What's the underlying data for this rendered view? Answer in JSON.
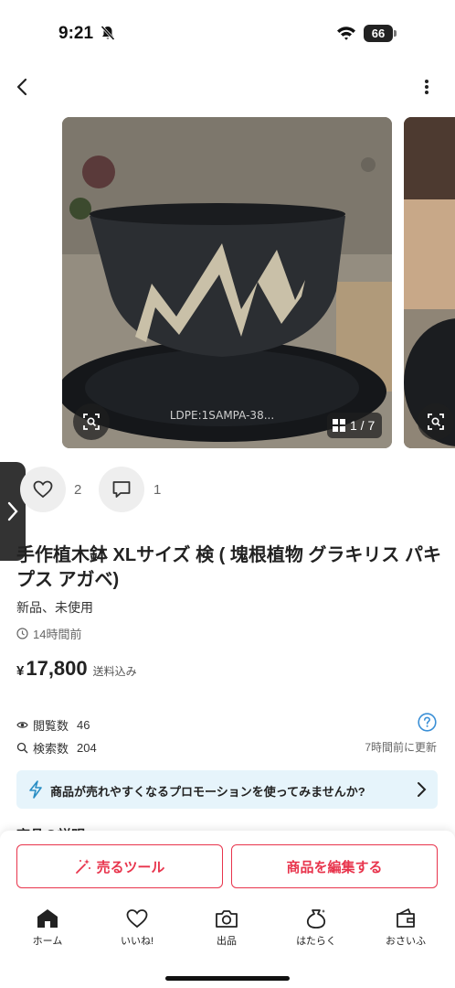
{
  "status_bar": {
    "time": "9:21",
    "battery": "66"
  },
  "gallery": {
    "counter": "1 / 7"
  },
  "actions": {
    "likes": "2",
    "comments": "1"
  },
  "item": {
    "title": "手作植木鉢 XLサイズ 検 ( 塊根植物 グラキリス パキプス アガベ)",
    "condition": "新品、未使用",
    "posted": "14時間前",
    "price_currency": "¥",
    "price": "17,800",
    "shipping": "送料込み"
  },
  "stats": {
    "views_label": "閲覧数",
    "views": "46",
    "searches_label": "検索数",
    "searches": "204",
    "updated": "7時間前に更新"
  },
  "promo": {
    "text": "商品が売れやすくなるプロモーションを使ってみませんか?"
  },
  "section": {
    "description_heading": "商品の説明"
  },
  "buttons": {
    "sell_tool": "売るツール",
    "edit": "商品を編集する"
  },
  "tabbar": {
    "home": "ホーム",
    "likes": "いいね!",
    "list": "出品",
    "work": "はたらく",
    "wallet": "おさいふ"
  },
  "colors": {
    "accent": "#e8344c",
    "promo_bg": "#e6f4fb",
    "help_blue": "#3a8fd6"
  }
}
